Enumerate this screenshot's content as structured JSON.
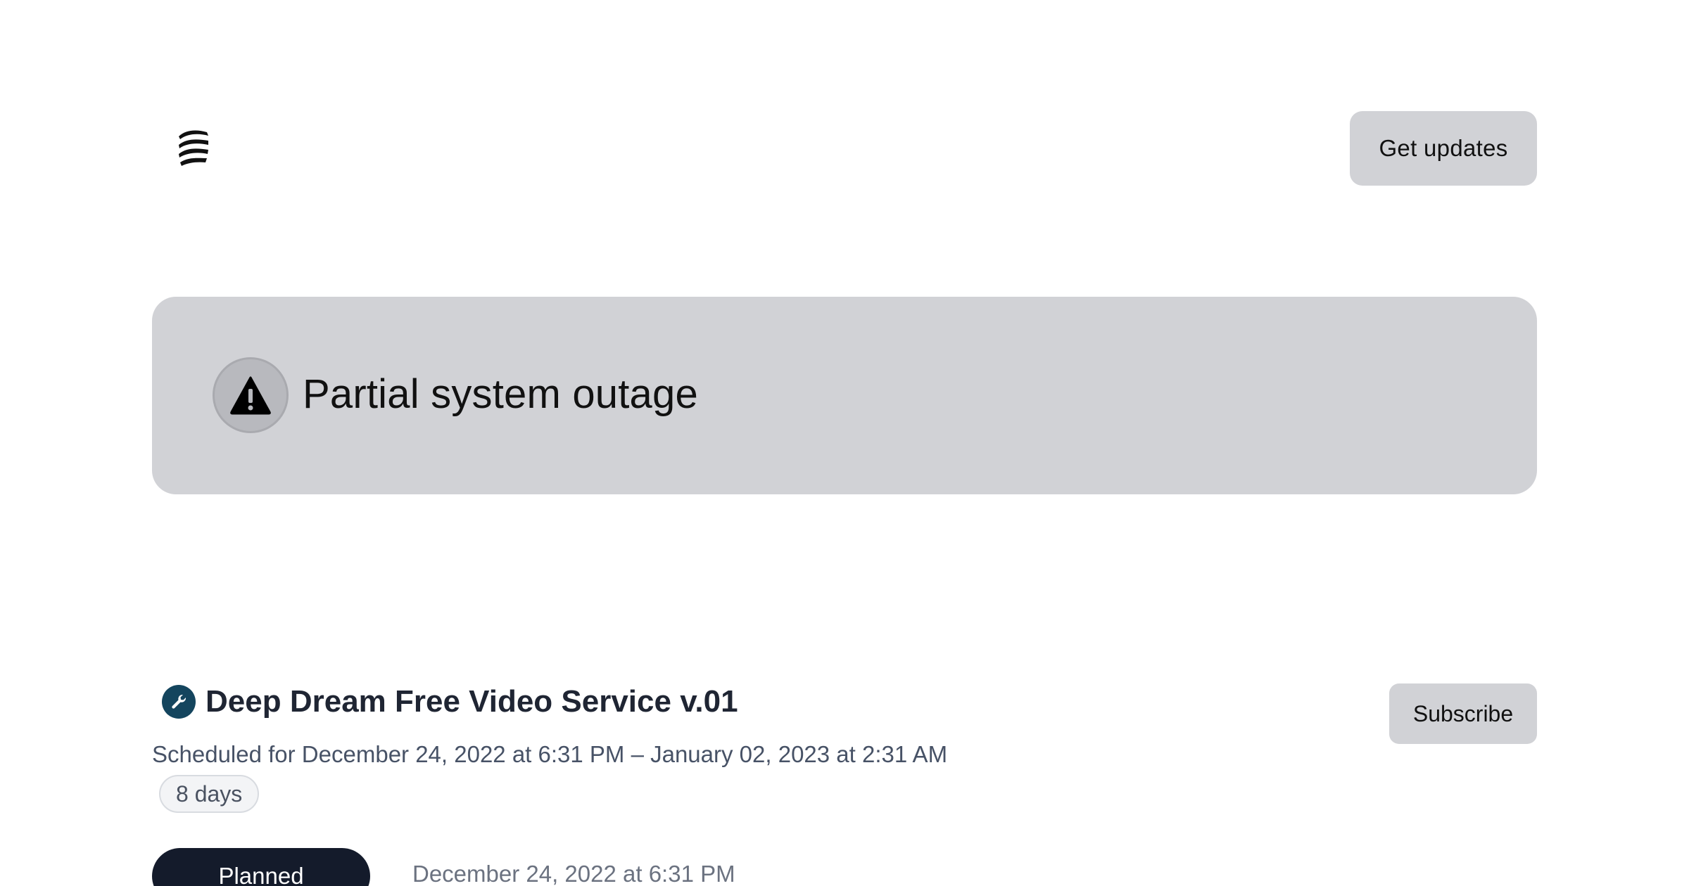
{
  "header": {
    "logo_icon": "stacked-waves-logo",
    "get_updates_label": "Get updates"
  },
  "status": {
    "icon": "warning-triangle-icon",
    "text": "Partial system outage",
    "banner_color": "#d1d2d6"
  },
  "maintenance": {
    "icon": "wrench-icon",
    "icon_color": "#14455e",
    "title": "Deep Dream Free Video Service v.01",
    "subscribe_label": "Subscribe",
    "schedule": "Scheduled for December 24, 2022 at 6:31 PM – January 02, 2023 at 2:31 AM",
    "duration": "8 days",
    "updates": [
      {
        "status": "Planned",
        "timestamp": "December 24, 2022 at 6:31 PM"
      }
    ]
  }
}
